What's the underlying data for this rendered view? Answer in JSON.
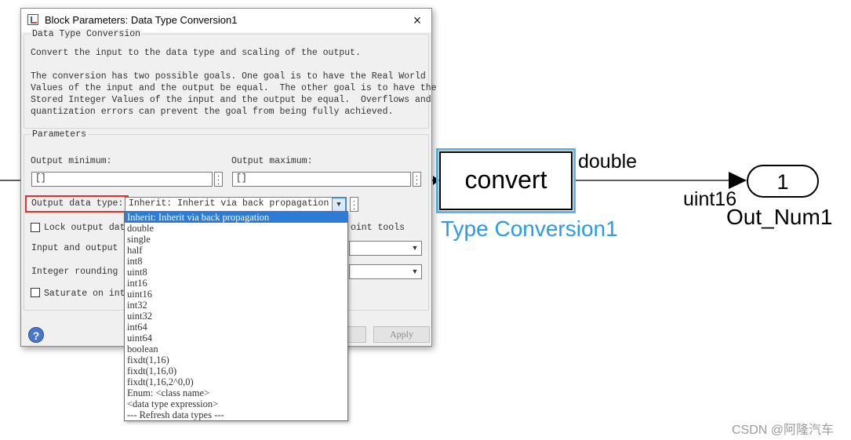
{
  "dialog": {
    "title": "Block Parameters: Data Type Conversion1",
    "close_glyph": "×",
    "description_group": {
      "title": "Data Type Conversion",
      "text": "Convert the input to the data type and scaling of the output.\n\nThe conversion has two possible goals. One goal is to have the Real World\nValues of the input and the output be equal.  The other goal is to have the\nStored Integer Values of the input and the output be equal.  Overflows and\nquantization errors can prevent the goal from being fully achieved."
    },
    "parameters_group": {
      "title": "Parameters",
      "output_minimum": {
        "label": "Output minimum:",
        "value": "[]"
      },
      "output_maximum": {
        "label": "Output maximum:",
        "value": "[]"
      },
      "output_data_type": {
        "label": "Output data type:",
        "value": "Inherit: Inherit via back propagation",
        "assistant_label": ">>"
      },
      "lock_output": {
        "label_visible": "Lock output data",
        "label_tail": "oint tools",
        "checked": false
      },
      "input_output_label": "Input and output t",
      "integer_rounding_label": "Integer rounding m",
      "saturate": {
        "label_visible": "Saturate on inte",
        "checked": false
      }
    },
    "buttons": {
      "apply": "Apply"
    },
    "dropdown_options": [
      "Inherit: Inherit via back propagation",
      "double",
      "single",
      "half",
      "int8",
      "uint8",
      "int16",
      "uint16",
      "int32",
      "uint32",
      "int64",
      "uint64",
      "boolean",
      "fixdt(1,16)",
      "fixdt(1,16,0)",
      "fixdt(1,16,2^0,0)",
      "Enum: <class name>",
      "<data type expression>",
      "--- Refresh data types ---"
    ],
    "dropdown_selected_index": 0
  },
  "model": {
    "block_label": "convert",
    "block_name": "Type Conversion1",
    "signal_in_label": "double",
    "signal_out_label": "uint16",
    "outport_number": "1",
    "outport_name": "Out_Num1",
    "selection_color": "#5ab4ee",
    "block_name_color": "#2a9be8"
  },
  "watermark": "CSDN @阿隆汽车"
}
